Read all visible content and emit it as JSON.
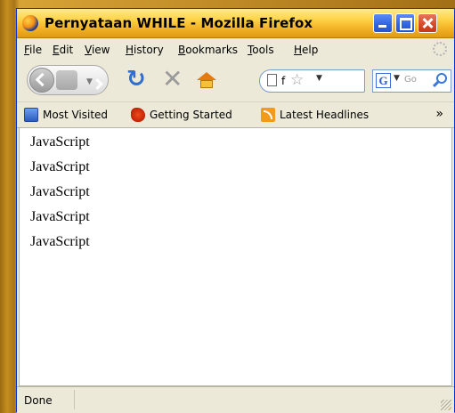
{
  "window": {
    "title": "Pernyataan WHILE - Mozilla Firefox"
  },
  "menubar": {
    "items": [
      "File",
      "Edit",
      "View",
      "History",
      "Bookmarks",
      "Tools",
      "Help"
    ]
  },
  "navbar": {
    "url_text": "f",
    "search_placeholder": "Go"
  },
  "bookmarks": {
    "items": [
      "Most Visited",
      "Getting Started",
      "Latest Headlines"
    ],
    "overflow": "»"
  },
  "content": {
    "lines": [
      "JavaScript",
      "JavaScript",
      "JavaScript",
      "JavaScript",
      "JavaScript"
    ]
  },
  "status": {
    "text": "Done"
  },
  "colors": {
    "title_bar": "#f4b52a",
    "chrome": "#ece9d8",
    "reload": "#2f6fce",
    "home": "#e47a10"
  }
}
